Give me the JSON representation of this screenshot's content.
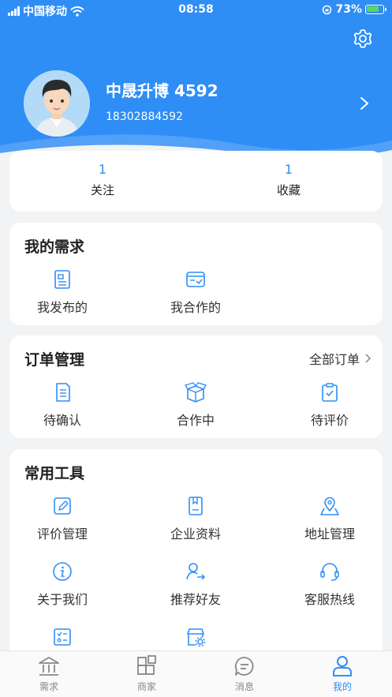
{
  "status_bar": {
    "carrier": "中国移动",
    "time": "08:58",
    "battery": "73%"
  },
  "profile": {
    "name": "中晟升博 4592",
    "phone": "18302884592"
  },
  "stats": [
    {
      "value": "1",
      "label": "关注"
    },
    {
      "value": "1",
      "label": "收藏"
    }
  ],
  "my_needs": {
    "title": "我的需求",
    "items": [
      {
        "label": "我发布的",
        "icon": "document-icon"
      },
      {
        "label": "我合作的",
        "icon": "cooperation-icon"
      }
    ]
  },
  "orders": {
    "title": "订单管理",
    "all_link": "全部订单",
    "items": [
      {
        "label": "待确认",
        "icon": "list-doc-icon"
      },
      {
        "label": "合作中",
        "icon": "box-icon"
      },
      {
        "label": "待评价",
        "icon": "clipboard-check-icon"
      }
    ]
  },
  "tools": {
    "title": "常用工具",
    "items": [
      {
        "label": "评价管理",
        "icon": "edit-icon"
      },
      {
        "label": "企业资料",
        "icon": "book-icon"
      },
      {
        "label": "地址管理",
        "icon": "map-pin-icon"
      },
      {
        "label": "关于我们",
        "icon": "info-icon"
      },
      {
        "label": "推荐好友",
        "icon": "user-share-icon"
      },
      {
        "label": "客服热线",
        "icon": "headset-icon"
      }
    ]
  },
  "tabbar": [
    {
      "label": "需求",
      "icon": "building-icon",
      "active": false
    },
    {
      "label": "商家",
      "icon": "grid-icon",
      "active": false
    },
    {
      "label": "消息",
      "icon": "message-icon",
      "active": false
    },
    {
      "label": "我的",
      "icon": "person-icon",
      "active": true
    }
  ],
  "colors": {
    "primary": "#2f8df6",
    "background": "#f2f3f5",
    "inactive": "#888888"
  }
}
